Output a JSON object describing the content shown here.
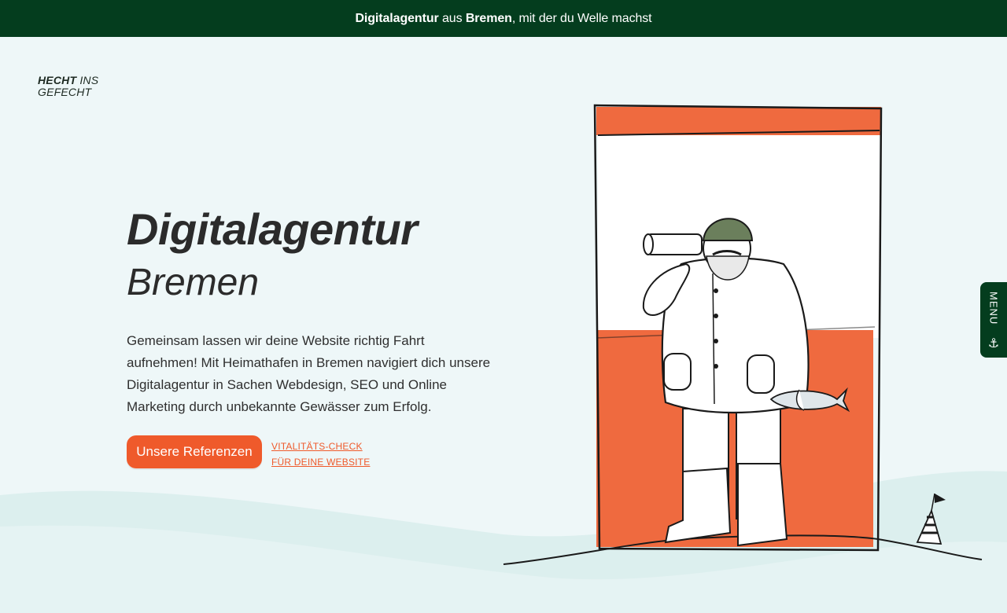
{
  "announcement": {
    "part1_bold": "Digitalagentur",
    "part2": " aus ",
    "part3_bold": "Bremen",
    "part4": ", mit der du Welle machst"
  },
  "logo": {
    "word1": "HECHT",
    "word2": "INS",
    "word3": "GEFECHT"
  },
  "hero": {
    "title_line1": "Digitalagentur",
    "title_line2": "Bremen",
    "paragraph": "Gemeinsam lassen wir deine Website richtig Fahrt aufnehmen! Mit Heimathafen in Bremen navigiert dich unsere Digitalagentur in Sachen Webdesign, SEO und Online Marketing durch unbekannte Gewässer zum Erfolg."
  },
  "cta": {
    "primary_label": "Unsere Referenzen",
    "secondary_line1": "VITALITÄTS-CHECK",
    "secondary_line2": "FÜR DEINE WEBSITE"
  },
  "menu": {
    "label": "MENU",
    "icon": "anchor-icon"
  },
  "colors": {
    "brand_green": "#043d1e",
    "accent_orange": "#ef5a2b",
    "background": "#eef7f8"
  },
  "illustration": {
    "subject": "lighthouse-with-fisherman"
  }
}
